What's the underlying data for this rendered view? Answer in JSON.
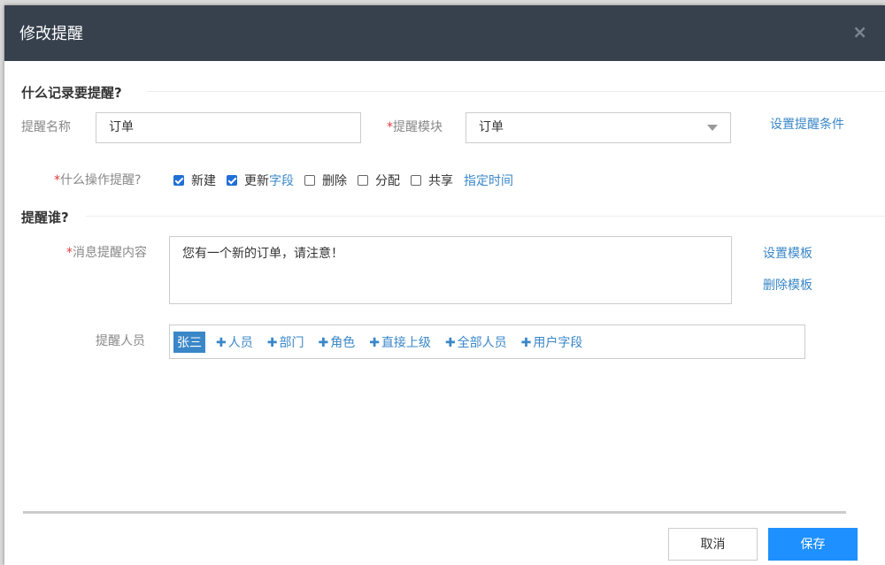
{
  "dialog": {
    "title": "修改提醒",
    "close_icon": "×"
  },
  "section1": {
    "title": "什么记录要提醒?"
  },
  "name_field": {
    "label": "提醒名称",
    "value": "订单"
  },
  "module_field": {
    "required_mark": "*",
    "label": "提醒模块",
    "value": "订单"
  },
  "set_conditions_link": "设置提醒条件",
  "operations": {
    "required_mark": "*",
    "label": "什么操作提醒?",
    "options": [
      {
        "label": "新建",
        "checked": true
      },
      {
        "label": "更新",
        "checked": true,
        "link": "字段"
      },
      {
        "label": "删除",
        "checked": false
      },
      {
        "label": "分配",
        "checked": false
      },
      {
        "label": "共享",
        "checked": false
      }
    ],
    "schedule_link": "指定时间"
  },
  "section2": {
    "title": "提醒谁?"
  },
  "message": {
    "required_mark": "*",
    "label": "消息提醒内容",
    "value": "您有一个新的订单，请注意！",
    "set_template_link": "设置模板",
    "delete_template_link": "删除模板"
  },
  "recipients": {
    "label": "提醒人员",
    "selected": [
      "张三"
    ],
    "add_buttons": [
      "人员",
      "部门",
      "角色",
      "直接上级",
      "全部人员",
      "用户字段"
    ]
  },
  "footer": {
    "cancel_label": "取消",
    "save_label": "保存"
  },
  "colors": {
    "header_bg": "#37404d",
    "accent": "#3a87c8",
    "primary_button": "#1e90ff",
    "required": "#e4393c"
  }
}
